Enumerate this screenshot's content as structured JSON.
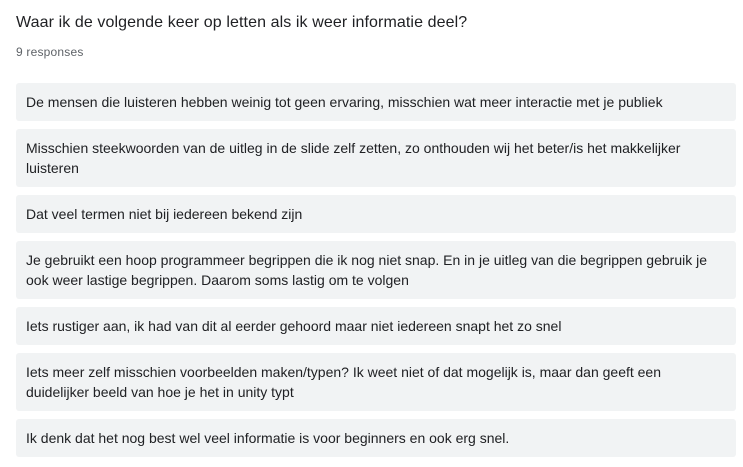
{
  "question": {
    "title": "Waar ik de volgende keer op letten als ik weer informatie deel?",
    "response_count": "9 responses"
  },
  "responses": [
    "De mensen die luisteren hebben weinig tot geen ervaring, misschien wat meer interactie met je publiek",
    "Misschien steekwoorden van de uitleg in de slide zelf zetten, zo onthouden wij het beter/is het makkelijker luisteren",
    "Dat veel termen niet bij iedereen bekend zijn",
    "Je gebruikt een hoop programmeer begrippen die ik nog niet snap. En in je uitleg van die begrippen gebruik je ook weer lastige begrippen. Daarom soms lastig om te volgen",
    "Iets rustiger aan, ik had van dit al eerder gehoord maar niet iedereen snapt het zo snel",
    "Iets meer zelf misschien voorbeelden maken/typen? Ik weet niet of dat mogelijk is, maar dan geeft een duidelijker beeld van hoe je het in unity typt",
    "Ik denk dat het nog best wel veel informatie is voor beginners en ook erg snel."
  ]
}
